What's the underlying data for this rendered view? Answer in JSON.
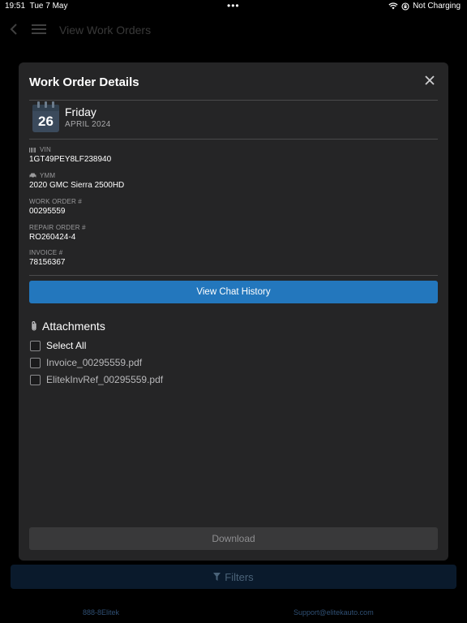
{
  "status_bar": {
    "time": "19:51",
    "date": "Tue 7 May",
    "dots": "•••",
    "battery_text": "Not Charging"
  },
  "background": {
    "title": "View Work Orders",
    "filters_label": "Filters",
    "footer_left": "888-8Elitek",
    "footer_right": "Support@elitekauto.com"
  },
  "modal": {
    "title": "Work Order Details",
    "date": {
      "day": "26",
      "weekday": "Friday",
      "month_year": "APRIL 2024"
    },
    "fields": [
      {
        "label": "VIN",
        "value": "1GT49PEY8LF238940",
        "icon": "barcode-icon"
      },
      {
        "label": "YMM",
        "value": "2020 GMC Sierra 2500HD",
        "icon": "car-icon"
      },
      {
        "label": "WORK ORDER #",
        "value": "00295559"
      },
      {
        "label": "REPAIR ORDER #",
        "value": "RO260424-4"
      },
      {
        "label": "INVOICE #",
        "value": "78156367"
      }
    ],
    "chat_button": "View Chat History",
    "attachments": {
      "title": "Attachments",
      "select_all": "Select All",
      "files": [
        "Invoice_00295559.pdf",
        "ElitekInvRef_00295559.pdf"
      ]
    },
    "download_button": "Download"
  },
  "colors": {
    "modal_bg": "#252526",
    "primary_button": "#2377bd",
    "disabled_button": "#39393a"
  }
}
